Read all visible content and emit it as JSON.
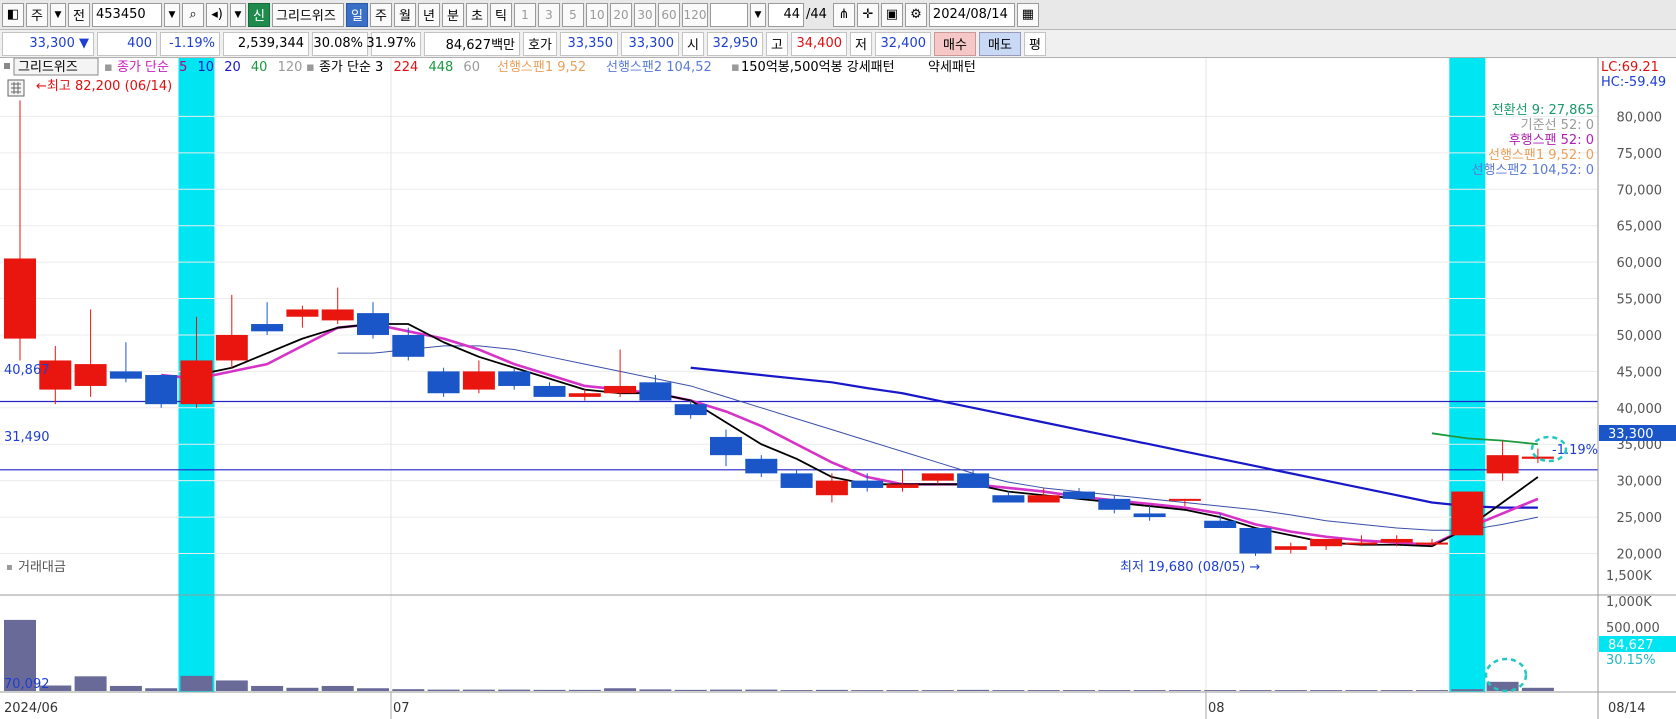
{
  "toolbar": {
    "period_label": "주",
    "prev_label": "전",
    "code_value": "453450",
    "new_badge": "신",
    "stock_name": "그리드위즈",
    "timeframes": [
      "일",
      "주",
      "월",
      "년",
      "분",
      "초",
      "틱"
    ],
    "timeframe_selected": "일",
    "intervals": [
      "1",
      "3",
      "5",
      "10",
      "20",
      "30",
      "60",
      "120"
    ],
    "count_value": "44",
    "count_total": "/44",
    "date_value": "2024/08/14"
  },
  "quote": {
    "price": "33,300",
    "change": "400",
    "change_pct": "-1.19%",
    "volume": "2,539,344",
    "ratio1": "30.08%",
    "ratio2": "31.97%",
    "amount": "84,627백만",
    "hoga_label": "호가",
    "ask": "33,350",
    "bid": "33,300",
    "open_label": "시",
    "open": "32,950",
    "high_label": "고",
    "high": "34,400",
    "low_label": "저",
    "low": "32,400",
    "buy_label": "매수",
    "sell_label": "매도",
    "eval_label": "평"
  },
  "legend": {
    "name": "그리드위즈",
    "ma1_label": "종가 단순",
    "ma1_periods": [
      "5",
      "10",
      "20",
      "40",
      "120"
    ],
    "ma2_label": "종가 단순 3",
    "ma2_periods": [
      "224",
      "448",
      "60"
    ],
    "span1": "선행스팬1 9,52",
    "span2": "선행스팬2 104,52",
    "pattern": "150억봉,500억봉 강세패턴",
    "weak": "약세패턴"
  },
  "ichimoku": {
    "conversion": "전환선 9: 27,865",
    "base": "기준선 52: 0",
    "lagging": "후행스팬 52: 0",
    "span1": "선행스팬1 9,52: 0",
    "span2": "선행스팬2 104,52: 0"
  },
  "lc_hc": {
    "lc": "LC:69.21",
    "hc": "HC:-59.49"
  },
  "annotations": {
    "high": "최고 82,200 (06/14)",
    "low": "최저 19,680 (08/05)",
    "hline1": "40,867",
    "hline2": "31,490",
    "price_tag": "33,300",
    "pct_tag": "-1.19%",
    "vol_tag": "84,627",
    "vol_pct_tag": "30.15%",
    "vol_ref": "70,092"
  },
  "volume_panel": {
    "title": "거래대금",
    "ticks": [
      "1,500K",
      "1,000K",
      "500,000"
    ]
  },
  "colors": {
    "up": "#e8160f",
    "down": "#1a56c8",
    "ma5": "#000000",
    "ma10": "#d633c8",
    "ma60": "#1818c8",
    "ma120": "#3a4ea8",
    "lagline": "#1a9a3c",
    "highlight": "#00e5f2",
    "hline": "#2424c8",
    "volume": "#6a6a98"
  },
  "chart_data": {
    "type": "candlestick",
    "ylim": [
      16500,
      85000
    ],
    "y_ticks": [
      20000,
      25000,
      30000,
      35000,
      40000,
      45000,
      50000,
      55000,
      60000,
      65000,
      70000,
      75000,
      80000
    ],
    "x_labels": [
      "2024/06",
      "07",
      "08",
      "08/14"
    ],
    "hlines": [
      40867,
      31490
    ],
    "highlight_indices": [
      5,
      41
    ],
    "candles": [
      {
        "o": 49500,
        "h": 82200,
        "l": 46500,
        "c": 60500
      },
      {
        "o": 42500,
        "h": 48500,
        "l": 40500,
        "c": 46500
      },
      {
        "o": 43000,
        "h": 53500,
        "l": 41500,
        "c": 46000
      },
      {
        "o": 45000,
        "h": 49000,
        "l": 43500,
        "c": 44000
      },
      {
        "o": 44500,
        "h": 44500,
        "l": 40000,
        "c": 40500
      },
      {
        "o": 40500,
        "h": 52500,
        "l": 40000,
        "c": 46500
      },
      {
        "o": 46500,
        "h": 55500,
        "l": 45500,
        "c": 50000
      },
      {
        "o": 51500,
        "h": 54500,
        "l": 50000,
        "c": 50500
      },
      {
        "o": 52500,
        "h": 54000,
        "l": 51000,
        "c": 53500
      },
      {
        "o": 52000,
        "h": 56500,
        "l": 51500,
        "c": 53500
      },
      {
        "o": 53000,
        "h": 54500,
        "l": 49500,
        "c": 50000
      },
      {
        "o": 50000,
        "h": 51000,
        "l": 46500,
        "c": 47000
      },
      {
        "o": 45000,
        "h": 45500,
        "l": 41500,
        "c": 42000
      },
      {
        "o": 42500,
        "h": 46500,
        "l": 42000,
        "c": 45000
      },
      {
        "o": 45000,
        "h": 45500,
        "l": 42500,
        "c": 43000
      },
      {
        "o": 43000,
        "h": 43500,
        "l": 41500,
        "c": 41500
      },
      {
        "o": 41500,
        "h": 42500,
        "l": 41000,
        "c": 42000
      },
      {
        "o": 42000,
        "h": 48000,
        "l": 41500,
        "c": 43000
      },
      {
        "o": 43500,
        "h": 44500,
        "l": 41000,
        "c": 41000
      },
      {
        "o": 40500,
        "h": 41000,
        "l": 38500,
        "c": 39000
      },
      {
        "o": 36000,
        "h": 37000,
        "l": 32000,
        "c": 33500
      },
      {
        "o": 33000,
        "h": 33500,
        "l": 30500,
        "c": 31000
      },
      {
        "o": 31000,
        "h": 31500,
        "l": 29000,
        "c": 29000
      },
      {
        "o": 28000,
        "h": 31000,
        "l": 27000,
        "c": 30000
      },
      {
        "o": 30000,
        "h": 31000,
        "l": 28500,
        "c": 29000
      },
      {
        "o": 29000,
        "h": 31500,
        "l": 28500,
        "c": 29500
      },
      {
        "o": 30000,
        "h": 31000,
        "l": 29500,
        "c": 31000
      },
      {
        "o": 31000,
        "h": 31500,
        "l": 29000,
        "c": 29000
      },
      {
        "o": 28000,
        "h": 28500,
        "l": 27000,
        "c": 27000
      },
      {
        "o": 27000,
        "h": 29000,
        "l": 27000,
        "c": 28000
      },
      {
        "o": 28500,
        "h": 29000,
        "l": 27500,
        "c": 27500
      },
      {
        "o": 27500,
        "h": 28000,
        "l": 25500,
        "c": 26000
      },
      {
        "o": 25500,
        "h": 26500,
        "l": 24500,
        "c": 25000
      },
      {
        "o": 27500,
        "h": 27500,
        "l": 26500,
        "c": 27500
      },
      {
        "o": 24500,
        "h": 25500,
        "l": 23500,
        "c": 23500
      },
      {
        "o": 23500,
        "h": 23500,
        "l": 19680,
        "c": 20000
      },
      {
        "o": 20500,
        "h": 21500,
        "l": 20000,
        "c": 21000
      },
      {
        "o": 21000,
        "h": 22000,
        "l": 20500,
        "c": 22000
      },
      {
        "o": 21500,
        "h": 22500,
        "l": 21000,
        "c": 21500
      },
      {
        "o": 21500,
        "h": 22500,
        "l": 21000,
        "c": 22000
      },
      {
        "o": 21500,
        "h": 22000,
        "l": 21000,
        "c": 21500
      },
      {
        "o": 22500,
        "h": 28500,
        "l": 22500,
        "c": 28500
      },
      {
        "o": 31000,
        "h": 35500,
        "l": 30000,
        "c": 33500
      },
      {
        "o": 33000,
        "h": 34400,
        "l": 32400,
        "c": 33300
      }
    ],
    "ma5": [
      [
        5,
        44500
      ],
      [
        6,
        45500
      ],
      [
        7,
        47500
      ],
      [
        8,
        49500
      ],
      [
        9,
        51000
      ],
      [
        10,
        51500
      ],
      [
        11,
        51500
      ],
      [
        12,
        49000
      ],
      [
        13,
        47000
      ],
      [
        14,
        45500
      ],
      [
        15,
        44000
      ],
      [
        16,
        42500
      ],
      [
        17,
        42000
      ],
      [
        18,
        42000
      ],
      [
        19,
        41000
      ],
      [
        20,
        38000
      ],
      [
        21,
        35000
      ],
      [
        22,
        33000
      ],
      [
        23,
        30500
      ],
      [
        24,
        29500
      ],
      [
        25,
        29500
      ],
      [
        26,
        29500
      ],
      [
        27,
        29500
      ],
      [
        28,
        28500
      ],
      [
        29,
        28000
      ],
      [
        30,
        27500
      ],
      [
        31,
        27000
      ],
      [
        32,
        26500
      ],
      [
        33,
        26000
      ],
      [
        34,
        25000
      ],
      [
        35,
        23500
      ],
      [
        36,
        22500
      ],
      [
        37,
        21500
      ],
      [
        38,
        21200
      ],
      [
        39,
        21200
      ],
      [
        40,
        21000
      ],
      [
        41,
        23500
      ],
      [
        42,
        27000
      ],
      [
        43,
        30500
      ]
    ],
    "ma10": [
      [
        4,
        44500
      ],
      [
        5,
        44000
      ],
      [
        6,
        45000
      ],
      [
        7,
        46000
      ],
      [
        8,
        48500
      ],
      [
        9,
        51000
      ],
      [
        10,
        51500
      ],
      [
        11,
        50500
      ],
      [
        12,
        49500
      ],
      [
        13,
        48000
      ],
      [
        14,
        46000
      ],
      [
        15,
        44500
      ],
      [
        16,
        43000
      ],
      [
        17,
        42500
      ],
      [
        18,
        42000
      ],
      [
        19,
        41000
      ],
      [
        20,
        39500
      ],
      [
        21,
        37500
      ],
      [
        22,
        35000
      ],
      [
        23,
        32500
      ],
      [
        24,
        30500
      ],
      [
        25,
        29500
      ],
      [
        26,
        29500
      ],
      [
        27,
        29500
      ],
      [
        28,
        29000
      ],
      [
        29,
        28500
      ],
      [
        30,
        27800
      ],
      [
        31,
        27300
      ],
      [
        32,
        26800
      ],
      [
        33,
        26300
      ],
      [
        34,
        25500
      ],
      [
        35,
        24000
      ],
      [
        36,
        23000
      ],
      [
        37,
        22300
      ],
      [
        38,
        21800
      ],
      [
        39,
        21500
      ],
      [
        40,
        21200
      ],
      [
        41,
        23500
      ],
      [
        42,
        25500
      ],
      [
        43,
        27500
      ]
    ],
    "ma20": [
      [
        9,
        47500
      ],
      [
        10,
        47500
      ],
      [
        11,
        48000
      ],
      [
        12,
        48500
      ],
      [
        13,
        48500
      ],
      [
        14,
        48000
      ],
      [
        15,
        47000
      ],
      [
        16,
        46000
      ],
      [
        17,
        45000
      ],
      [
        18,
        44000
      ],
      [
        19,
        43000
      ],
      [
        20,
        41500
      ],
      [
        21,
        40000
      ],
      [
        22,
        38500
      ],
      [
        23,
        37000
      ],
      [
        24,
        35500
      ],
      [
        25,
        34000
      ],
      [
        26,
        32500
      ],
      [
        27,
        31000
      ],
      [
        28,
        29800
      ],
      [
        29,
        29000
      ],
      [
        30,
        28500
      ],
      [
        31,
        28000
      ],
      [
        32,
        27500
      ],
      [
        33,
        27000
      ],
      [
        34,
        26500
      ],
      [
        35,
        26000
      ],
      [
        36,
        25300
      ],
      [
        37,
        24500
      ],
      [
        38,
        24000
      ],
      [
        39,
        23500
      ],
      [
        40,
        23200
      ],
      [
        41,
        23200
      ],
      [
        42,
        24000
      ],
      [
        43,
        25000
      ]
    ],
    "ma60": [
      [
        19,
        45500
      ],
      [
        20,
        45000
      ],
      [
        21,
        44500
      ],
      [
        22,
        44000
      ],
      [
        23,
        43500
      ],
      [
        24,
        42700
      ],
      [
        25,
        42000
      ],
      [
        26,
        41000
      ],
      [
        27,
        40000
      ],
      [
        28,
        39000
      ],
      [
        29,
        38000
      ],
      [
        30,
        37000
      ],
      [
        31,
        36000
      ],
      [
        32,
        35000
      ],
      [
        33,
        34000
      ],
      [
        34,
        33000
      ],
      [
        35,
        32000
      ],
      [
        36,
        31000
      ],
      [
        37,
        30000
      ],
      [
        38,
        29000
      ],
      [
        39,
        28000
      ],
      [
        40,
        27000
      ],
      [
        41,
        26500
      ],
      [
        42,
        26300
      ],
      [
        43,
        26300
      ]
    ],
    "lagline": [
      [
        40,
        36500
      ],
      [
        41,
        35800
      ],
      [
        42,
        35500
      ],
      [
        43,
        35000
      ]
    ],
    "volume": {
      "max": 1700,
      "values": [
        1550,
        120,
        320,
        110,
        60,
        330,
        230,
        110,
        70,
        110,
        60,
        40,
        30,
        30,
        30,
        25,
        25,
        60,
        35,
        25,
        30,
        30,
        20,
        25,
        20,
        20,
        20,
        25,
        20,
        20,
        20,
        20,
        20,
        20,
        20,
        20,
        20,
        20,
        20,
        20,
        20,
        40,
        200,
        70
      ]
    }
  }
}
